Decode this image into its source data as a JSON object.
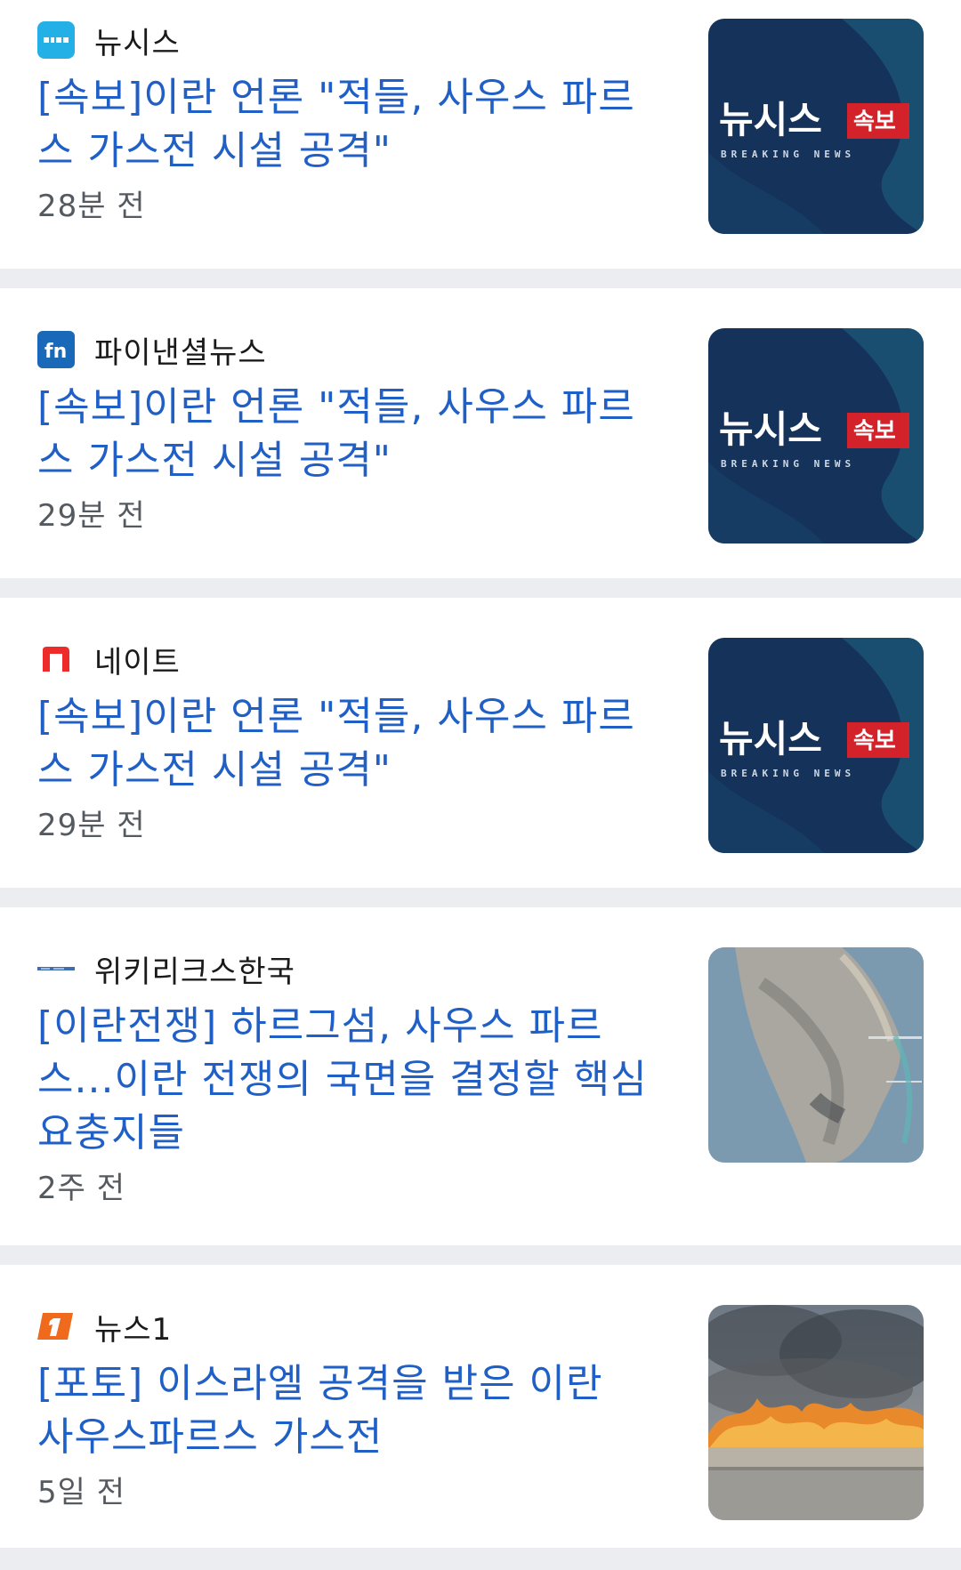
{
  "articles": [
    {
      "source": "뉴시스",
      "source_icon": "newsis-logo-icon",
      "headline": "[속보]이란 언론 \"적들, 사우스 파르스 가스전 시설 공격\"",
      "time": "28분 전",
      "thumbnail": "breaking-news-thumbnail",
      "thumb_brand": "뉴시스",
      "thumb_badge": "속보",
      "thumb_sub": "BREAKING NEWS"
    },
    {
      "source": "파이낸셜뉴스",
      "source_icon": "fn-logo-icon",
      "headline": "[속보]이란 언론 \"적들, 사우스 파르스 가스전 시설 공격\"",
      "time": "29분 전",
      "thumbnail": "breaking-news-thumbnail",
      "thumb_brand": "뉴시스",
      "thumb_badge": "속보",
      "thumb_sub": "BREAKING NEWS"
    },
    {
      "source": "네이트",
      "source_icon": "nate-logo-icon",
      "headline": "[속보]이란 언론 \"적들, 사우스 파르스 가스전 시설 공격\"",
      "time": "29분 전",
      "thumbnail": "breaking-news-thumbnail",
      "thumb_brand": "뉴시스",
      "thumb_badge": "속보",
      "thumb_sub": "BREAKING NEWS"
    },
    {
      "source": "위키리크스한국",
      "source_icon": "wikileaks-korea-logo-icon",
      "headline": "[이란전쟁] 하르그섬, 사우스 파르스...이란 전쟁의 국면을 결정할 핵심 요충지들",
      "time": "2주 전",
      "thumbnail": "satellite-island-thumbnail"
    },
    {
      "source": "뉴스1",
      "source_icon": "news1-logo-icon",
      "headline": "[포토] 이스라엘 공격을 받은 이란 사우스파르스 가스전",
      "time": "5일 전",
      "thumbnail": "gas-field-fire-thumbnail"
    }
  ],
  "colors": {
    "headline": "#1f5fc6",
    "timestamp": "#555a60",
    "background": "#ecedf1",
    "card": "#ffffff"
  }
}
